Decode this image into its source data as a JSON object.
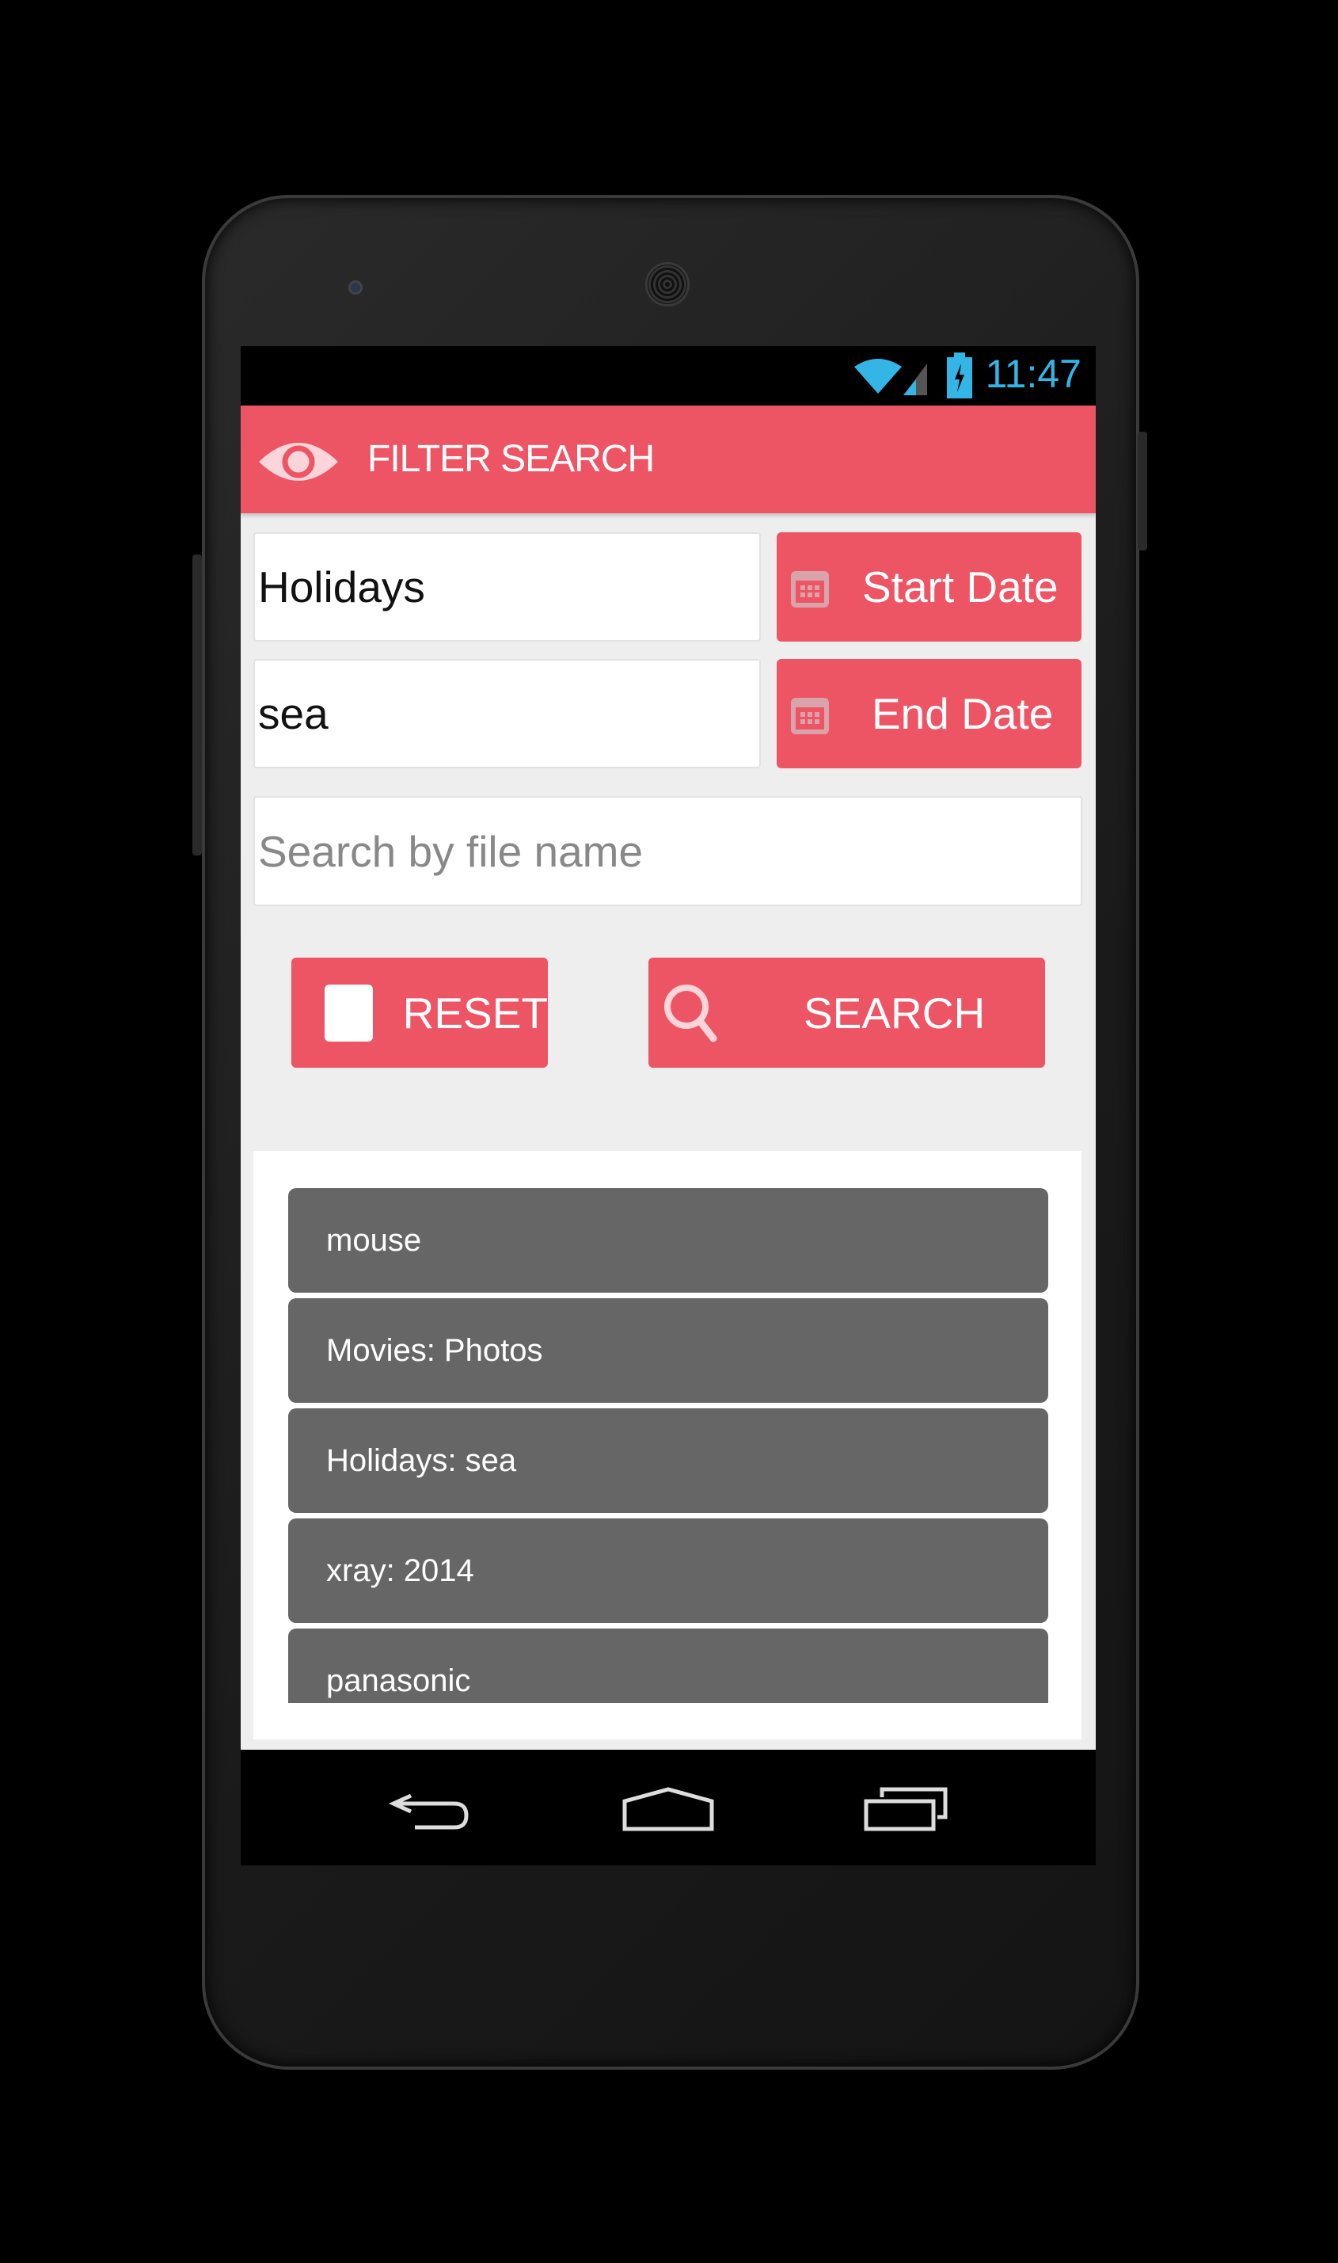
{
  "status_bar": {
    "time": "11:47",
    "icons": [
      "wifi-icon",
      "signal-icon",
      "battery-charging-icon"
    ]
  },
  "app_bar": {
    "title": "FILTER SEARCH",
    "icon": "eye-icon"
  },
  "form": {
    "category_value": "Holidays",
    "tag_value": "sea",
    "start_date_label": "Start Date",
    "end_date_label": "End Date",
    "filename_placeholder": "Search by file name",
    "reset_label": "RESET",
    "search_label": "SEARCH"
  },
  "results": [
    "mouse",
    "Movies: Photos",
    "Holidays: sea",
    "xray: 2014",
    "panasonic"
  ],
  "colors": {
    "accent": "#ed5565",
    "list_item": "#666666",
    "status_time": "#33b5e5"
  }
}
